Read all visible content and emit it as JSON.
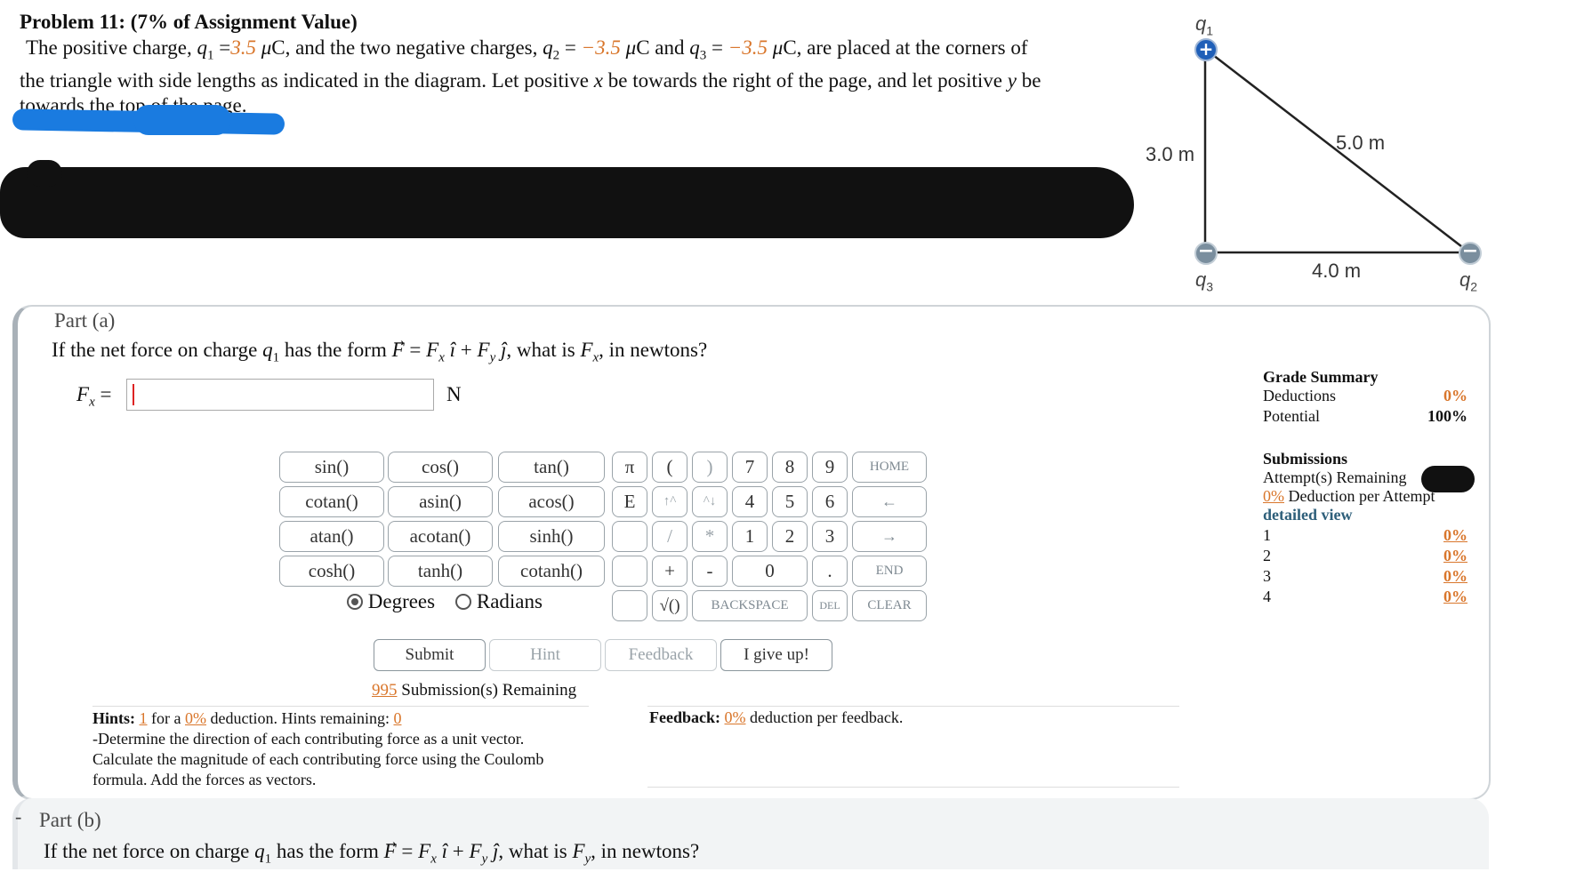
{
  "problem": {
    "title": "Problem 11: (7% of Assignment Value)",
    "q1_value": "3.5",
    "q2_value": "−3.5",
    "q3_value": "−3.5",
    "unit_uc": "μC"
  },
  "diagram": {
    "q1_label": "q1",
    "q2_label": "q2",
    "q3_label": "q3",
    "side_vertical": "3.0 m",
    "side_hypotenuse": "5.0 m",
    "side_horizontal": "4.0 m"
  },
  "part_a": {
    "title": "Part (a)",
    "question_end": ", what is",
    "input_value": "",
    "unit": "N"
  },
  "keypad": {
    "functions": [
      "sin()",
      "cos()",
      "tan()",
      "cotan()",
      "asin()",
      "acos()",
      "atan()",
      "acotan()",
      "sinh()",
      "cosh()",
      "tanh()",
      "cotanh()"
    ],
    "degrees": "Degrees",
    "radians": "Radians",
    "pi": "π",
    "open_paren": "(",
    "close_paren": ")",
    "e": "E",
    "up": "↑^",
    "down": "^↓",
    "slash": "/",
    "star": "*",
    "plus": "+",
    "minus": "-",
    "sqrt": "√()",
    "digits_row1": [
      "7",
      "8",
      "9"
    ],
    "digits_row2": [
      "4",
      "5",
      "6"
    ],
    "digits_row3": [
      "1",
      "2",
      "3"
    ],
    "zero": "0",
    "dot": ".",
    "home": "HOME",
    "left_arrow": "←",
    "right_arrow": "→",
    "end": "END",
    "backspace": "BACKSPACE",
    "del": "DEL",
    "clear": "CLEAR"
  },
  "actions": {
    "submit": "Submit",
    "hint": "Hint",
    "feedback": "Feedback",
    "give_up": "I give up!"
  },
  "submissions": {
    "remaining_count": "995",
    "remaining_text": "Submission(s) Remaining"
  },
  "hints": {
    "label": "Hints:",
    "count": "1",
    "for_a": "for a",
    "deduction": "0%",
    "deduction_text": "deduction. Hints remaining:",
    "remaining": "0",
    "text_line1": "-Determine the direction of each contributing force as a unit vector.",
    "text_line2": "Calculate the magnitude of each contributing force using the Coulomb",
    "text_line3": "formula. Add the forces as vectors."
  },
  "feedback": {
    "label": "Feedback:",
    "deduction": "0%",
    "text": "deduction per feedback."
  },
  "grade_summary": {
    "title": "Grade Summary",
    "deductions_label": "Deductions",
    "deductions_value": "0%",
    "potential_label": "Potential",
    "potential_value": "100%",
    "submissions_title": "Submissions",
    "attempts_label": "Attempt(s) Remaining",
    "deduction_pct": "0%",
    "deduction_per_attempt": "Deduction per Attempt",
    "detailed_view": "detailed view",
    "attempts": [
      {
        "n": "1",
        "pct": "0%"
      },
      {
        "n": "2",
        "pct": "0%"
      },
      {
        "n": "3",
        "pct": "0%"
      },
      {
        "n": "4",
        "pct": "0%"
      }
    ]
  },
  "part_b": {
    "toggle": "-",
    "title": "Part (b)",
    "question_end": ", what is"
  },
  "colors": {
    "accent_orange": "#d9762b",
    "charge_positive": "#1f5fb8",
    "charge_negative": "#7a8e9e",
    "redaction_blue": "#1a7be0"
  }
}
